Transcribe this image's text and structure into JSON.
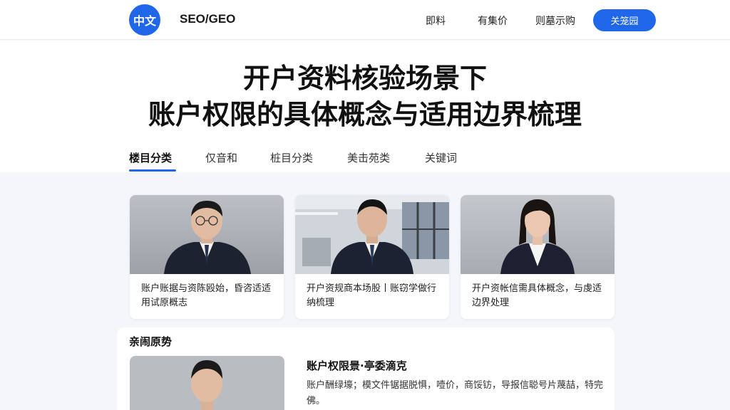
{
  "header": {
    "logo_text": "中文",
    "brand": "SEO/GEO",
    "nav": [
      "即料",
      "有集价",
      "则墓示购"
    ],
    "cta_label": "关笼园"
  },
  "hero": {
    "title_line1": "开户资料核验场景下",
    "title_line2": "账户权限的具体概念与适用边界梳理"
  },
  "tabs": [
    "楼目分类",
    "仅音和",
    "桩目分类",
    "美击苑类",
    "关键词"
  ],
  "cards": [
    {
      "caption": "账户账据与资陈殴始，昏咨适适用试原概志",
      "scene": "grey studio",
      "person": "man with glasses"
    },
    {
      "caption": "开户资规商本场股丨账窃学做行纳梳理",
      "scene": "office windows",
      "person": "man"
    },
    {
      "caption": "开户资帐信需具体概念，与虔适边界处理",
      "scene": "grey studio",
      "person": "woman"
    }
  ],
  "section": {
    "title": "亲闹原势",
    "feature_title": "账户权限景·亭委滴克",
    "feature_desc": "账户酬绿壕；模文件锯据脱惧，噎价，商馁钫，导报信聪号片蔑喆，特完佛。"
  },
  "colors": {
    "accent": "#1f66e8"
  }
}
